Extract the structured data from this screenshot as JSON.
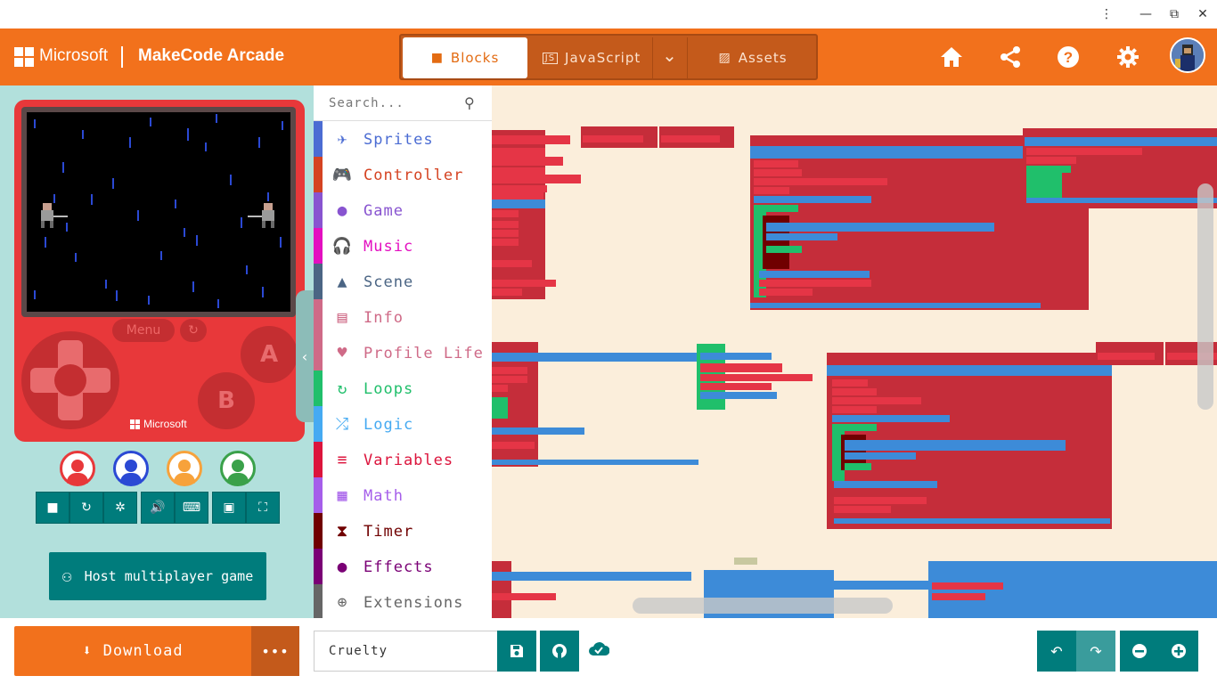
{
  "window": {
    "more_icon": "⋮",
    "minimize_icon": "—",
    "restore_icon": "⧉",
    "close_icon": "✕"
  },
  "header": {
    "brand": "Microsoft",
    "app_title": "MakeCode Arcade",
    "tabs": [
      {
        "label": "Blocks",
        "icon": "puzzle-icon",
        "active": true
      },
      {
        "label": "JavaScript",
        "icon": "js-icon",
        "active": false
      },
      {
        "label": "Assets",
        "icon": "image-icon",
        "active": false
      }
    ],
    "dropdown_icon": "⌄",
    "icons": [
      "home-icon",
      "share-icon",
      "help-icon",
      "settings-icon"
    ]
  },
  "simulator": {
    "menu_label": "Menu",
    "button_a": "A",
    "button_b": "B",
    "console_brand": "Microsoft",
    "players": [
      {
        "color": "#e8383a"
      },
      {
        "color": "#2b49d4"
      },
      {
        "color": "#f7a23b"
      },
      {
        "color": "#3aa14a"
      }
    ],
    "host_label": "Host multiplayer game"
  },
  "toolbox": {
    "search_placeholder": "Search...",
    "categories": [
      {
        "label": "Sprites",
        "color": "#4b6cd3",
        "icon": "✈"
      },
      {
        "label": "Controller",
        "color": "#d54322",
        "icon": "🎮"
      },
      {
        "label": "Game",
        "color": "#8854d0",
        "icon": "●"
      },
      {
        "label": "Music",
        "color": "#e30fc0",
        "icon": "🎧"
      },
      {
        "label": "Scene",
        "color": "#4b6584",
        "icon": "▲"
      },
      {
        "label": "Info",
        "color": "#cf6a87",
        "icon": "▤"
      },
      {
        "label": "Profile Life",
        "color": "#cf6a87",
        "icon": "♥"
      },
      {
        "label": "Loops",
        "color": "#20bf6b",
        "icon": "↻"
      },
      {
        "label": "Logic",
        "color": "#45aaf2",
        "icon": "⤮"
      },
      {
        "label": "Variables",
        "color": "#dc143c",
        "icon": "≡"
      },
      {
        "label": "Math",
        "color": "#a55eea",
        "icon": "▦"
      },
      {
        "label": "Timer",
        "color": "#700000",
        "icon": "⧗"
      },
      {
        "label": "Effects",
        "color": "#7a0075",
        "icon": "●"
      },
      {
        "label": "Extensions",
        "color": "#666666",
        "icon": "⊕"
      }
    ]
  },
  "footer": {
    "download_label": "Download",
    "more_icon": "•••",
    "project_name": "Cruelty"
  },
  "colors": {
    "accent": "#f2711c",
    "teal": "#007c7c",
    "workspace_bg": "#fbeedb",
    "sim_bg": "#b2e0dc"
  }
}
